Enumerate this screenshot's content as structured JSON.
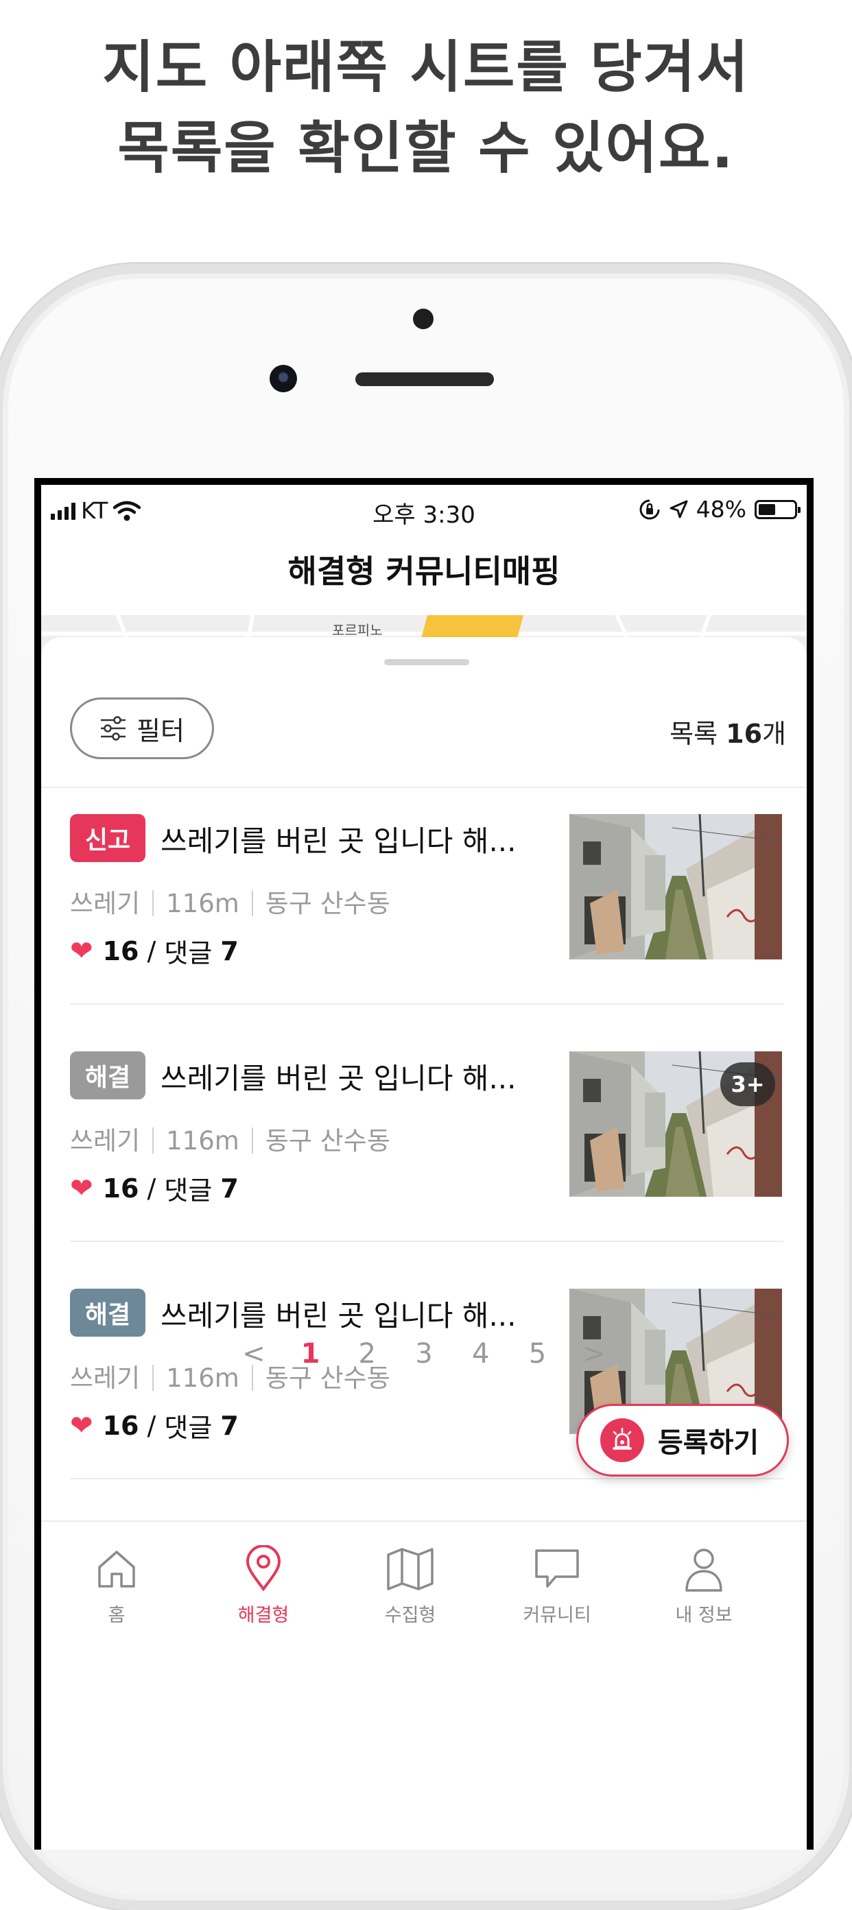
{
  "headline": {
    "line1": "지도 아래쪽 시트를 당겨서",
    "line2": "목록을 확인할 수 있어요."
  },
  "status_bar": {
    "carrier": "KT",
    "time": "오후 3:30",
    "battery": "48%",
    "battery_level": 0.48
  },
  "app": {
    "title": "해결형 커뮤니티매핑",
    "map_label": "포르피노"
  },
  "list": {
    "filter_label": "필터",
    "count_prefix": "목록",
    "count_value": "16",
    "count_suffix": "개",
    "items": [
      {
        "badge": "신고",
        "badge_color": "#e6375a",
        "title": "쓰레기를 버린 곳 입니다 해...",
        "category": "쓰레기",
        "distance": "116m",
        "location": "동구 산수동",
        "likes": "16",
        "comments_label": "댓글",
        "comments": "7",
        "photo_more": ""
      },
      {
        "badge": "해결",
        "badge_color": "#9a9a9a",
        "title": "쓰레기를 버린 곳 입니다 해...",
        "category": "쓰레기",
        "distance": "116m",
        "location": "동구 산수동",
        "likes": "16",
        "comments_label": "댓글",
        "comments": "7",
        "photo_more": "3+"
      },
      {
        "badge": "해결",
        "badge_color": "#6d8898",
        "title": "쓰레기를 버린 곳 입니다 해...",
        "category": "쓰레기",
        "distance": "116m",
        "location": "동구 산수동",
        "likes": "16",
        "comments_label": "댓글",
        "comments": "7",
        "photo_more": ""
      }
    ]
  },
  "pagination": {
    "prev": "<",
    "pages": [
      "1",
      "2",
      "3",
      "4",
      "5"
    ],
    "current": "1",
    "next": ">"
  },
  "register_button": {
    "label": "등록하기"
  },
  "tabs": [
    {
      "label": "홈",
      "icon": "home-icon"
    },
    {
      "label": "해결형",
      "icon": "location-pin-icon",
      "active": true
    },
    {
      "label": "수집형",
      "icon": "map-icon"
    },
    {
      "label": "커뮤니티",
      "icon": "chat-bubble-icon"
    },
    {
      "label": "내 정보",
      "icon": "user-icon"
    }
  ],
  "colors": {
    "accent": "#e6375a",
    "map_highlight": "#f7c33d"
  }
}
